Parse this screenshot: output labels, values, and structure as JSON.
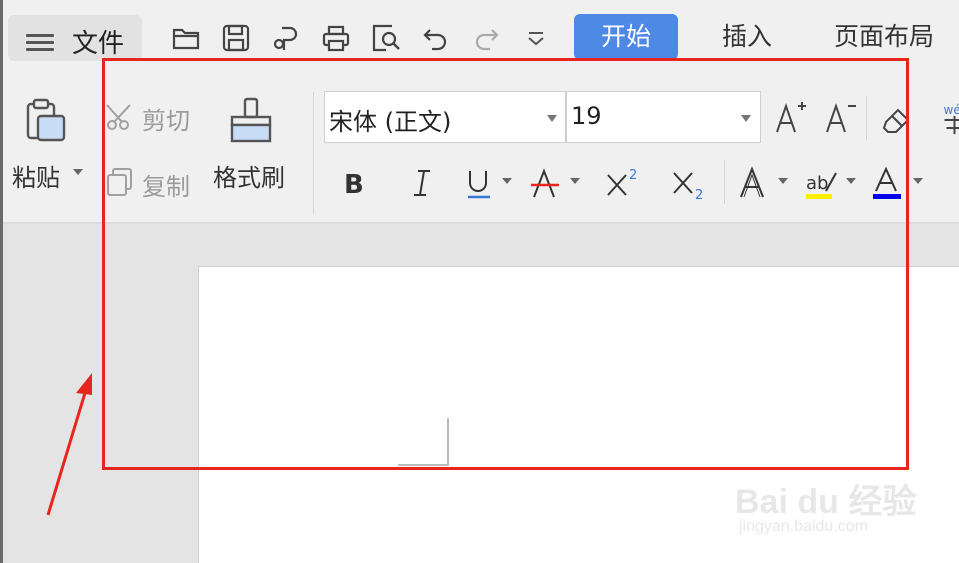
{
  "menu": {
    "label": "文件"
  },
  "tabs": [
    "开始",
    "插入",
    "页面布局"
  ],
  "clipboard": {
    "paste_label": "粘贴",
    "cut_label": "剪切",
    "copy_label": "复制",
    "format_painter_label": "格式刷"
  },
  "font": {
    "family": "宋体 (正文)",
    "size": "19"
  },
  "watermark": {
    "brand": "Bai du 经验",
    "sub": "jingyan.baidu.com"
  },
  "colors": {
    "accent": "#4f89e6",
    "annotation": "#e8241f",
    "highlight": "#ffee00",
    "font_color": "#0000ee"
  }
}
